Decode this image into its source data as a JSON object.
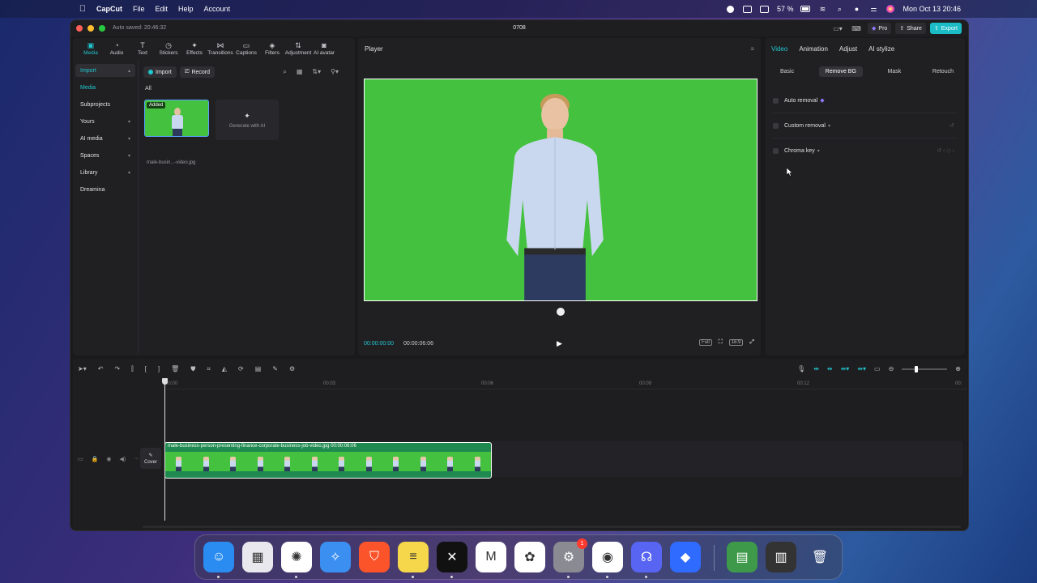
{
  "menubar": {
    "app": "CapCut",
    "items": [
      "File",
      "Edit",
      "Help",
      "Account"
    ],
    "battery": "57 %",
    "clock": "Mon Oct 13  20:46"
  },
  "window": {
    "autosaved": "Auto saved: 20:46:32",
    "title": "0708",
    "pro": "Pro",
    "share": "Share",
    "export": "Export"
  },
  "tools": [
    {
      "label": "Media",
      "icon": "▣"
    },
    {
      "label": "Audio",
      "icon": "◔"
    },
    {
      "label": "Text",
      "icon": "T"
    },
    {
      "label": "Stickers",
      "icon": "◷"
    },
    {
      "label": "Effects",
      "icon": "✦"
    },
    {
      "label": "Transitions",
      "icon": "⋈"
    },
    {
      "label": "Captions",
      "icon": "▭"
    },
    {
      "label": "Filters",
      "icon": "◈"
    },
    {
      "label": "Adjustment",
      "icon": "⇅"
    },
    {
      "label": "AI avatar",
      "icon": "◙"
    }
  ],
  "sidenav": [
    {
      "label": "Import",
      "chev": "▴"
    },
    {
      "label": "Media",
      "chev": ""
    },
    {
      "label": "Subprojects",
      "chev": ""
    },
    {
      "label": "Yours",
      "chev": "▾"
    },
    {
      "label": "AI media",
      "chev": "▾"
    },
    {
      "label": "Spaces",
      "chev": "▾"
    },
    {
      "label": "Library",
      "chev": "▾"
    },
    {
      "label": "Dreamina",
      "chev": ""
    }
  ],
  "media": {
    "import": "Import",
    "record": "Record",
    "filter_all": "All",
    "thumb_badge": "Added",
    "thumb_name": "male-busin...-video.jpg",
    "generate": "Generate with AI"
  },
  "player": {
    "title": "Player",
    "time_current": "00:00:00:00",
    "time_total": "00:00:06:06",
    "full": "Full",
    "ratio": "16:9"
  },
  "inspector": {
    "tabs": [
      "Video",
      "Animation",
      "Adjust",
      "AI stylize"
    ],
    "subtabs": [
      "Basic",
      "Remove BG",
      "Mask",
      "Retouch"
    ],
    "options": [
      "Auto removal",
      "Custom removal",
      "Chroma key"
    ]
  },
  "timeline": {
    "ticks": [
      "00:00",
      "00:03",
      "00:06",
      "00:09",
      "00:12",
      "00:"
    ],
    "clip_label": "male-business-person-presenting-finance-corporate-business-job-video.jpg   00:00:06:06",
    "cover": "Cover",
    "frames": 12
  },
  "dock": {
    "apps": [
      {
        "name": "finder",
        "glyph": "☺",
        "color": "#2a8cf0"
      },
      {
        "name": "launchpad",
        "glyph": "▦",
        "color": "#e8e8ee"
      },
      {
        "name": "chatgpt",
        "glyph": "✺",
        "color": "#ffffff"
      },
      {
        "name": "safari",
        "glyph": "✧",
        "color": "#3a8ff0"
      },
      {
        "name": "brave",
        "glyph": "⛉",
        "color": "#fb542b"
      },
      {
        "name": "notes",
        "glyph": "≡",
        "color": "#f6d64a"
      },
      {
        "name": "capcut",
        "glyph": "✕",
        "color": "#111111"
      },
      {
        "name": "gmail",
        "glyph": "M",
        "color": "#ffffff"
      },
      {
        "name": "photos",
        "glyph": "✿",
        "color": "#ffffff"
      },
      {
        "name": "system-settings",
        "glyph": "⚙",
        "color": "#8a8a92"
      },
      {
        "name": "chrome",
        "glyph": "◉",
        "color": "#ffffff"
      },
      {
        "name": "discord",
        "glyph": "☊",
        "color": "#5865f2"
      },
      {
        "name": "app-store-like",
        "glyph": "◆",
        "color": "#2f6bff"
      },
      {
        "name": "downloads-folder",
        "glyph": "▤",
        "color": "#3e9a4a"
      },
      {
        "name": "recent-window",
        "glyph": "▥",
        "color": "#333"
      },
      {
        "name": "trash",
        "glyph": "🗑",
        "color": "transparent"
      }
    ],
    "settings_badge": "1"
  }
}
